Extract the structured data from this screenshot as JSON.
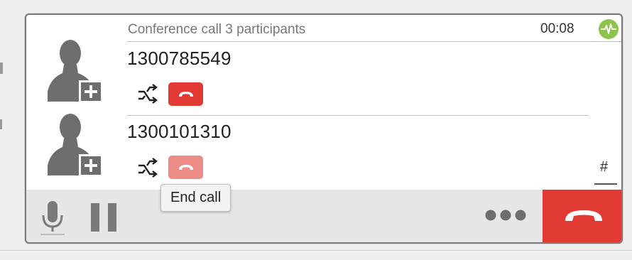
{
  "call": {
    "title": "Conference call 3 participants",
    "timer": "00:08",
    "status_icon": "activity-icon",
    "status_color": "#8cc34a"
  },
  "participants": [
    {
      "number": "1300785549",
      "avatar_icon": "add-contact-icon",
      "transfer_icon": "transfer-icon",
      "hangup_icon": "phone-hangup-icon",
      "hangup_color": "#e03a32"
    },
    {
      "number": "1300101310",
      "avatar_icon": "add-contact-icon",
      "transfer_icon": "transfer-icon",
      "hangup_icon": "phone-hangup-icon",
      "hangup_color": "#ec8c86"
    }
  ],
  "dialpad": {
    "label": "#"
  },
  "toolbar": {
    "mute_icon": "microphone-icon",
    "hold_icon": "pause-icon",
    "more_icon": "more-dots-icon",
    "end_call_icon": "phone-hangup-icon",
    "end_call_color": "#e03a32"
  },
  "tooltip": {
    "text": "End call"
  }
}
